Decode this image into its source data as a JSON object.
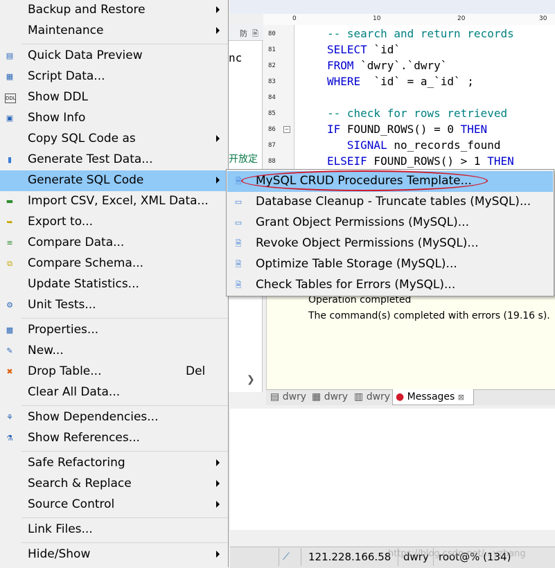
{
  "menu": {
    "items": [
      {
        "label": "Backup and Restore",
        "icon": "",
        "has_submenu": true
      },
      {
        "label": "Maintenance",
        "icon": "",
        "has_submenu": true
      },
      {
        "label": "Quick Data Preview",
        "icon": "table-preview-icon"
      },
      {
        "label": "Script Data...",
        "icon": "script-data-icon"
      },
      {
        "label": "Show DDL",
        "icon": "ddl-icon"
      },
      {
        "label": "Show Info",
        "icon": "info-icon"
      },
      {
        "label": "Copy SQL Code as",
        "icon": "",
        "has_submenu": true
      },
      {
        "label": "Generate Test Data...",
        "icon": "test-data-icon"
      },
      {
        "label": "Generate SQL Code",
        "icon": "",
        "has_submenu": true,
        "highlighted": true
      },
      {
        "label": "Import CSV, Excel, XML Data...",
        "icon": "import-icon"
      },
      {
        "label": "Export to...",
        "icon": "export-icon"
      },
      {
        "label": "Compare Data...",
        "icon": "compare-data-icon"
      },
      {
        "label": "Compare Schema...",
        "icon": "compare-schema-icon"
      },
      {
        "label": "Update Statistics...",
        "icon": ""
      },
      {
        "label": "Unit Tests...",
        "icon": "unit-tests-icon"
      },
      {
        "label": "Properties...",
        "icon": "properties-icon"
      },
      {
        "label": "New...",
        "icon": "new-icon"
      },
      {
        "label": "Drop Table...",
        "icon": "delete-icon",
        "shortcut": "Del"
      },
      {
        "label": "Clear All Data...",
        "icon": ""
      },
      {
        "label": "Show Dependencies...",
        "icon": "dependencies-icon"
      },
      {
        "label": "Show References...",
        "icon": "references-icon"
      },
      {
        "label": "Safe Refactoring",
        "icon": "",
        "has_submenu": true
      },
      {
        "label": "Search & Replace",
        "icon": "",
        "has_submenu": true
      },
      {
        "label": "Source Control",
        "icon": "",
        "has_submenu": true
      },
      {
        "label": "Link Files...",
        "icon": ""
      },
      {
        "label": "Hide/Show",
        "icon": "",
        "has_submenu": true
      }
    ]
  },
  "submenu": {
    "items": [
      {
        "label": "MySQL CRUD Procedures Template...",
        "icon": "template-icon",
        "highlighted": true,
        "circled": true
      },
      {
        "label": "Database Cleanup - Truncate tables (MySQL)...",
        "icon": "cleanup-icon"
      },
      {
        "label": "Grant Object Permissions (MySQL)...",
        "icon": "grant-icon"
      },
      {
        "label": "Revoke Object Permissions (MySQL)...",
        "icon": "revoke-icon"
      },
      {
        "label": "Optimize Table Storage (MySQL)...",
        "icon": "optimize-icon"
      },
      {
        "label": "Check Tables for Errors (MySQL)...",
        "icon": "check-icon"
      }
    ]
  },
  "editor": {
    "ruler": [
      "0",
      "10",
      "20",
      "30"
    ],
    "line_numbers": [
      "80",
      "81",
      "82",
      "83",
      "84",
      "85",
      "86",
      "87",
      "88"
    ],
    "lines": [
      {
        "text": "-- search and return records",
        "kind": "comment"
      },
      {
        "kw": "SELECT",
        "rest": " `id`"
      },
      {
        "kw": "FROM",
        "rest": " `dwry`.`dwry`"
      },
      {
        "kw": "WHERE",
        "rest": "  `id` = a_`id` ;"
      },
      {
        "text": "",
        "kind": "blank"
      },
      {
        "text": "-- check for rows retrieved",
        "kind": "comment"
      },
      {
        "kw": "IF",
        "rest": " FOUND_ROWS() = 0 ",
        "kw2": "THEN"
      },
      {
        "kw": "   SIGNAL",
        "rest": " no_records_found"
      },
      {
        "kw": "ELSEIF",
        "rest": " FOUND_ROWS() > 1 ",
        "kw2": "THEN"
      }
    ]
  },
  "left_pane": {
    "tab_a": "防",
    "tab_b": "🖹",
    "text_nc": "nc",
    "text_cn": "开放定"
  },
  "messages": {
    "line1": "Operation completed",
    "line2": "The command(s) completed with errors (19.16 s)."
  },
  "result_tabs": [
    {
      "label": "dwry"
    },
    {
      "label": "dwry"
    },
    {
      "label": "dwry"
    },
    {
      "label": "Messages",
      "active": true,
      "closable": "⊠"
    }
  ],
  "status_bar": {
    "host": "121.228.166.58",
    "database": "dwry",
    "user": "root@% (134)",
    "watermark": "https://blog.csdn.net/...yzhang"
  },
  "colors": {
    "highlight": "#91c9f7",
    "annotation_oval": "#d11a2a",
    "keyword": "#0000d0",
    "comment": "#008080"
  }
}
